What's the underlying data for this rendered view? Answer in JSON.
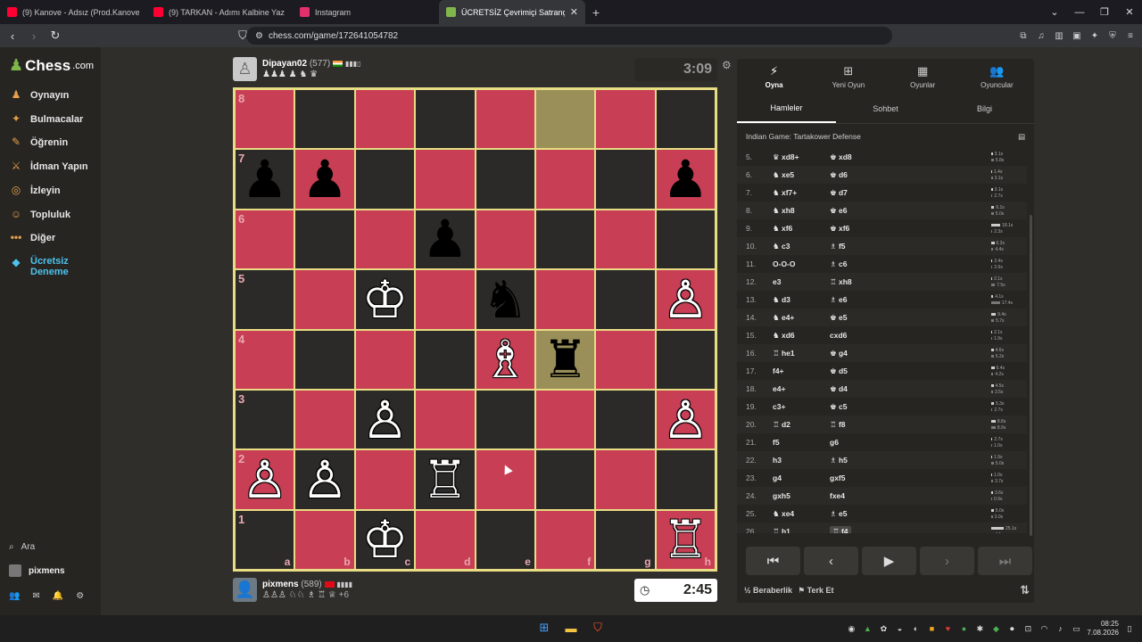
{
  "browser": {
    "tabs": [
      {
        "title": "(9) Kanove - Adsız (Prod.Kanove) - Yo",
        "color": "#ff0033",
        "active": false
      },
      {
        "title": "(9) TARKAN - Adımı Kalbine Yaz (",
        "color": "#ff0033",
        "active": false
      },
      {
        "title": "Instagram",
        "color": "#e1306c",
        "active": false
      },
      {
        "title": "ÜCRETSİZ Çevrimiçi Satranç Oy",
        "color": "#81b64c",
        "active": true
      }
    ],
    "url": "chess.com/game/172641054782"
  },
  "sidebar": {
    "logo_main": "Chess",
    "logo_suffix": ".com",
    "items": [
      {
        "label": "Oynayın",
        "icon": "play-icon"
      },
      {
        "label": "Bulmacalar",
        "icon": "puzzle-icon"
      },
      {
        "label": "Öğrenin",
        "icon": "learn-icon"
      },
      {
        "label": "İdman Yapın",
        "icon": "train-icon"
      },
      {
        "label": "İzleyin",
        "icon": "watch-icon"
      },
      {
        "label": "Topluluk",
        "icon": "community-icon"
      },
      {
        "label": "Diğer",
        "icon": "more-icon"
      }
    ],
    "premium_line1": "Ücretsiz",
    "premium_line2": "Deneme",
    "search_label": "Ara",
    "user_label": "pixmens"
  },
  "top_player": {
    "name": "Dipayan02",
    "rating": "(577)",
    "captured": "♟♟♟ ♟ ♞ ♛",
    "clock": "3:09"
  },
  "bottom_player": {
    "name": "pixmens",
    "rating": "(589)",
    "captured": "♙♙♙ ♘♘ ♗ ♖ ♕",
    "advantage": "+6",
    "clock": "2:45"
  },
  "board": {
    "ranks": [
      "8",
      "7",
      "6",
      "5",
      "4",
      "3",
      "2",
      "1"
    ],
    "files": [
      "a",
      "b",
      "c",
      "d",
      "e",
      "f",
      "g",
      "h"
    ],
    "pieces": {
      "a7": "♟b",
      "b7": "♟b",
      "h7": "♟b",
      "d6": "♟b",
      "c5": "♔w",
      "e5": "♞b",
      "h5": "♙w",
      "e4": "♗w",
      "f4": "♜b",
      "c3": "♙w",
      "h3": "♙w",
      "a2": "♙w",
      "b2": "♙w",
      "d2": "♖w",
      "c1": "♔w",
      "h1": "♖w"
    },
    "highlight": [
      "f8",
      "f4"
    ]
  },
  "panel": {
    "tabs": [
      {
        "label": "Oyna",
        "icon": "bolt-icon"
      },
      {
        "label": "Yeni Oyun",
        "icon": "plus-icon"
      },
      {
        "label": "Oyunlar",
        "icon": "board-icon"
      },
      {
        "label": "Oyuncular",
        "icon": "players-icon"
      }
    ],
    "subtabs": [
      "Hamleler",
      "Sohbet",
      "Bilgi"
    ],
    "opening": "Indian Game: Tartakower Defense",
    "moves": [
      {
        "n": "5.",
        "w": "♛ xd8+",
        "b": "♚ xd8",
        "tw": "3.1s",
        "tb": "5.8s",
        "fw": 0.12,
        "fb": 0.2
      },
      {
        "n": "6.",
        "w": "♞ xe5",
        "b": "♚ d6",
        "tw": "1.4s",
        "tb": "3.1s",
        "fw": 0.06,
        "fb": 0.12
      },
      {
        "n": "7.",
        "w": "♞ xf7+",
        "b": "♚ d7",
        "tw": "3.1s",
        "tb": "2.7s",
        "fw": 0.12,
        "fb": 0.1
      },
      {
        "n": "8.",
        "w": "♞ xh8",
        "b": "♚ e6",
        "tw": "6.1s",
        "tb": "5.0s",
        "fw": 0.24,
        "fb": 0.2
      },
      {
        "n": "9.",
        "w": "♞ xf6",
        "b": "♚ xf6",
        "tw": "18.1s",
        "tb": "2.3s",
        "fw": 0.72,
        "fb": 0.09
      },
      {
        "n": "10.",
        "w": "♞ c3",
        "b": "♗ f5",
        "tw": "6.3s",
        "tb": "4.4s",
        "fw": 0.25,
        "fb": 0.17
      },
      {
        "n": "11.",
        "w": "O-O-O",
        "b": "♗ c6",
        "tw": "2.4s",
        "tb": "2.6s",
        "fw": 0.1,
        "fb": 0.1
      },
      {
        "n": "12.",
        "w": "e3",
        "b": "♖ xh8",
        "tw": "2.1s",
        "tb": "7.5s",
        "fw": 0.08,
        "fb": 0.3
      },
      {
        "n": "13.",
        "w": "♞ d3",
        "b": "♗ e6",
        "tw": "4.1s",
        "tb": "17.4s",
        "fw": 0.16,
        "fb": 0.7
      },
      {
        "n": "14.",
        "w": "♞ e4+",
        "b": "♚ e5",
        "tw": "9.4s",
        "tb": "5.7s",
        "fw": 0.37,
        "fb": 0.22
      },
      {
        "n": "15.",
        "w": "♞ xd6",
        "b": "cxd6",
        "tw": "2.1s",
        "tb": "1.9s",
        "fw": 0.08,
        "fb": 0.07
      },
      {
        "n": "16.",
        "w": "♖ he1",
        "b": "♚ g4",
        "tw": "4.6s",
        "tb": "5.2s",
        "fw": 0.18,
        "fb": 0.2
      },
      {
        "n": "17.",
        "w": "f4+",
        "b": "♚ d5",
        "tw": "6.4s",
        "tb": "4.2s",
        "fw": 0.25,
        "fb": 0.17
      },
      {
        "n": "18.",
        "w": "e4+",
        "b": "♚ d4",
        "tw": "4.5s",
        "tb": "3.5s",
        "fw": 0.18,
        "fb": 0.14
      },
      {
        "n": "19.",
        "w": "c3+",
        "b": "♚ c5",
        "tw": "5.3s",
        "tb": "2.7s",
        "fw": 0.21,
        "fb": 0.1
      },
      {
        "n": "20.",
        "w": "♖ d2",
        "b": "♖ f8",
        "tw": "8.8s",
        "tb": "8.9s",
        "fw": 0.35,
        "fb": 0.35
      },
      {
        "n": "21.",
        "w": "f5",
        "b": "g6",
        "tw": "2.7s",
        "tb": "1.0s",
        "fw": 0.1,
        "fb": 0.04
      },
      {
        "n": "22.",
        "w": "h3",
        "b": "♗ h5",
        "tw": "1.9s",
        "tb": "5.0s",
        "fw": 0.07,
        "fb": 0.2
      },
      {
        "n": "23.",
        "w": "g4",
        "b": "gxf5",
        "tw": "1.0s",
        "tb": "3.7s",
        "fw": 0.04,
        "fb": 0.14
      },
      {
        "n": "24.",
        "w": "gxh5",
        "b": "fxe4",
        "tw": "3.6s",
        "tb": "0.9s",
        "fw": 0.14,
        "fb": 0.03
      },
      {
        "n": "25.",
        "w": "♞ xe4",
        "b": "♗ e5",
        "tw": "5.0s",
        "tb": "3.0s",
        "fw": 0.2,
        "fb": 0.12
      },
      {
        "n": "26.",
        "w": "♖ h1",
        "b": "♖ f4",
        "tw": "25.1s",
        "tb": "4.1s",
        "fw": 1.0,
        "fb": 0.16
      }
    ],
    "draw_label": "Beraberlik",
    "draw_prefix": "½",
    "resign_label": "Terk Et"
  },
  "taskbar": {
    "time": "08:25",
    "date": "7.08.2026"
  }
}
